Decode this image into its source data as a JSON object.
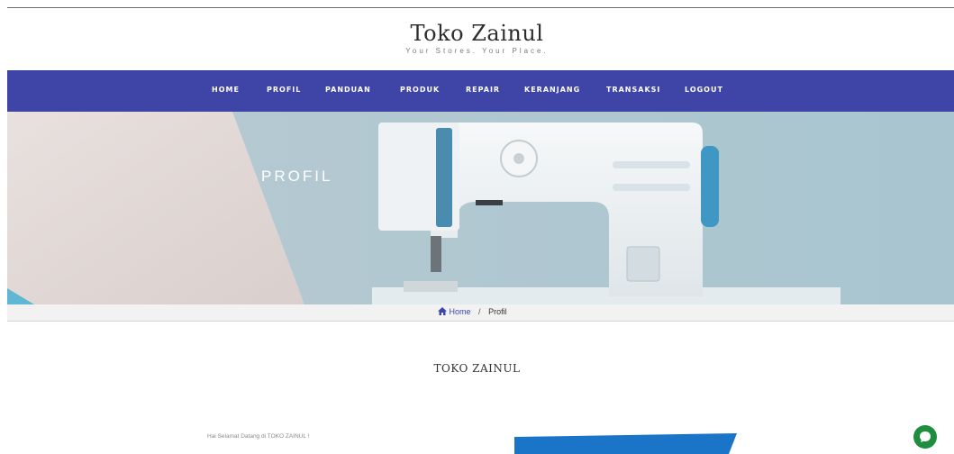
{
  "header": {
    "title": "Toko Zainul",
    "tagline": "Your Stores. Your Place."
  },
  "nav": {
    "items": [
      {
        "label": "HOME"
      },
      {
        "label": "PROFIL"
      },
      {
        "label": "PANDUAN"
      },
      {
        "label": "PRODUK"
      },
      {
        "label": "REPAIR"
      },
      {
        "label": "KERANJANG"
      },
      {
        "label": "TRANSAKSI"
      },
      {
        "label": "LOGOUT"
      }
    ],
    "background_color": "#3f45a7"
  },
  "hero": {
    "title": "PROFIL",
    "image_subject": "sewing machine"
  },
  "breadcrumb": {
    "home_label": "Home",
    "separator": "/",
    "current_label": "Profil",
    "home_icon": "home-icon"
  },
  "content": {
    "section_title": "TOKO ZAINUL",
    "welcome_text": "Hai Selamat Datang di TOKO ZAINUL !"
  },
  "chat": {
    "icon": "chat-bubble-icon",
    "color": "#1e8e3e"
  }
}
